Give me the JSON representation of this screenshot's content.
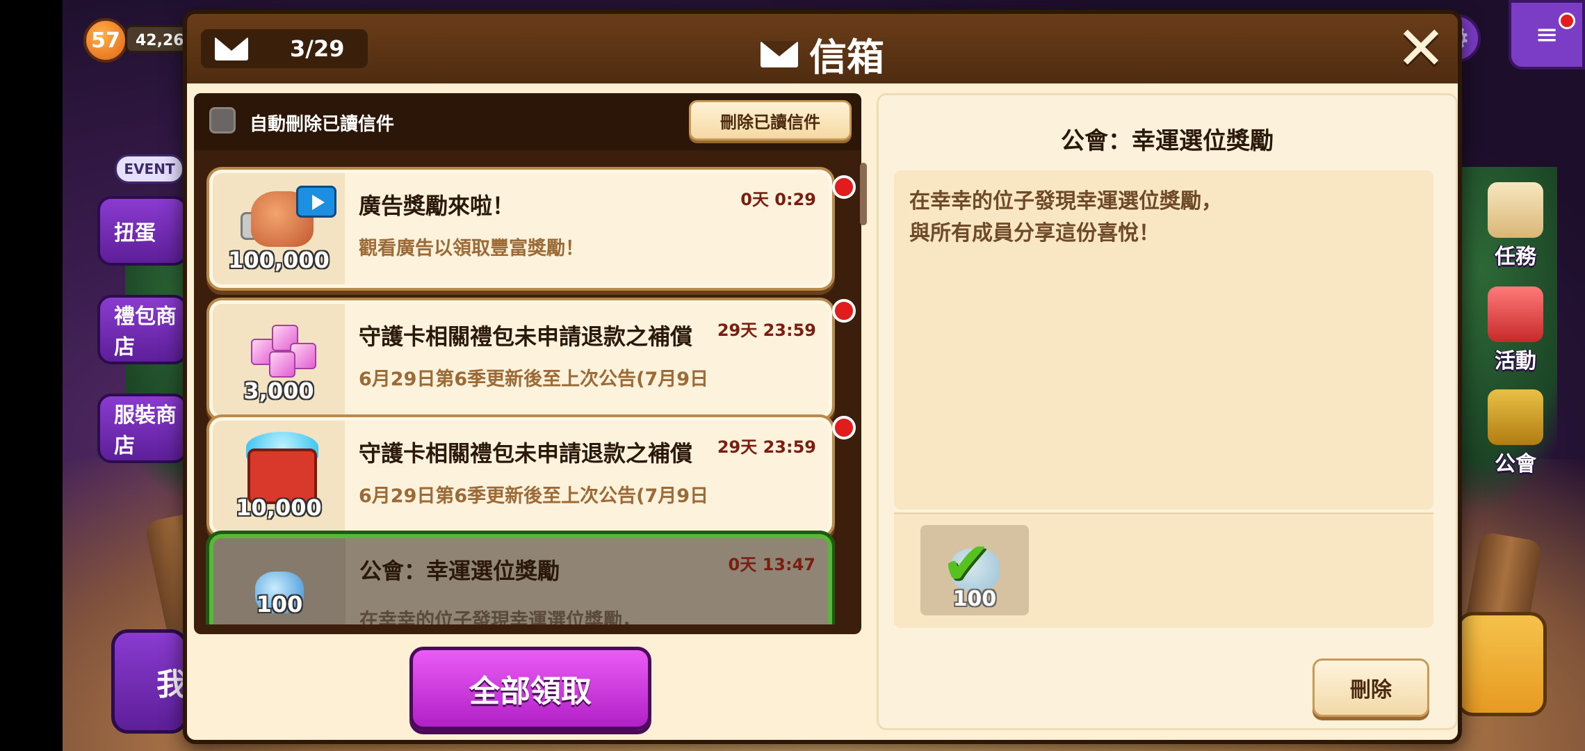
{
  "hud": {
    "level": "57",
    "currency": "42,26",
    "event_tag": "EVENT",
    "left_menu": [
      "扭蛋",
      "禮包商店",
      "服裝商店"
    ],
    "right_menu": [
      "任務",
      "活動",
      "公會"
    ],
    "bottom_left_label": "我",
    "settings_icon": "⚙",
    "menu_icon": "≡"
  },
  "dialog": {
    "counter": "3/29",
    "title": "信箱",
    "close": "✕",
    "auto_delete_label": "自動刪除已讀信件",
    "delete_read_button": "刪除已讀信件",
    "claim_all_button": "全部領取",
    "mails": [
      {
        "title": "廣告獎勵來啦！",
        "subtitle": "觀看廣告以領取豐富獎勵！",
        "time": "0天 0:29",
        "amount": "100,000",
        "icon": "coin-bag-video-icon",
        "unread": true
      },
      {
        "title": "守護卡相關禮包未申請退款之補償",
        "subtitle": "6月29日第6季更新後至上次公告(7月9日",
        "time": "29天 23:59",
        "amount": "3,000",
        "icon": "crystal-cubes-icon",
        "unread": true
      },
      {
        "title": "守護卡相關禮包未申請退款之補償",
        "subtitle": "6月29日第6季更新後至上次公告(7月9日",
        "time": "29天 23:59",
        "amount": "10,000",
        "icon": "gem-chest-icon",
        "unread": true
      },
      {
        "title": "公會：幸運選位獎勵",
        "subtitle": "在幸幸的位子發現幸運選位獎勵，",
        "time": "0天 13:47",
        "amount": "100",
        "icon": "gem-icon",
        "unread": false,
        "selected": true
      }
    ],
    "detail": {
      "title": "公會：幸運選位獎勵",
      "body_line1": "在幸幸的位子發現幸運選位獎勵，",
      "body_line2": "與所有成員分享這份喜悅！",
      "reward_amount": "100",
      "reward_claimed_icon": "check-icon",
      "delete_button": "刪除"
    }
  }
}
